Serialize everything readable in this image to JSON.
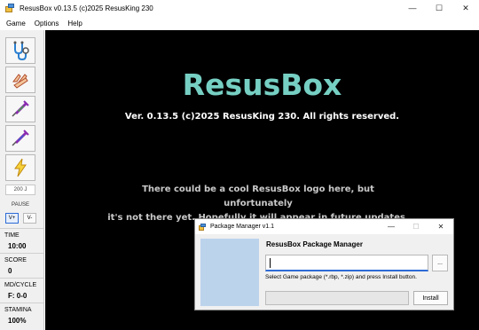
{
  "window": {
    "title": "ResusBox v0.13.5 (c)2025 ResusKing 230",
    "minimize_glyph": "—",
    "maximize_glyph": "☐",
    "close_glyph": "✕"
  },
  "menu": {
    "items": [
      {
        "label": "Game"
      },
      {
        "label": "Options"
      },
      {
        "label": "Help"
      }
    ]
  },
  "sidebar": {
    "tools": [
      {
        "icon": "stethoscope-icon"
      },
      {
        "icon": "hands-cpr-icon"
      },
      {
        "icon": "syringe-green-icon"
      },
      {
        "icon": "syringe-blue-icon"
      },
      {
        "icon": "lightning-icon"
      }
    ],
    "energy_value": "200 J",
    "pause_label": "PAUSE",
    "volume_up_label": "V+",
    "volume_down_label": "V-",
    "stats": [
      {
        "label": "TIME",
        "value": "10:00"
      },
      {
        "label": "SCORE",
        "value": "0"
      },
      {
        "label": "MD/CYCLE",
        "value": "F: 0-0"
      },
      {
        "label": "STAMINA",
        "value": "100%"
      }
    ]
  },
  "canvas": {
    "title": "ResusBox",
    "version_line": "Ver. 0.13.5 (c)2025 ResusKing 230. All rights reserved.",
    "notice_line1": "There could be a cool ResusBox logo here, but unfortunately",
    "notice_line2": "it's not there yet. Hopefully it will appear in future updates."
  },
  "package_manager": {
    "title": "Package Manager v1.1",
    "heading": "ResusBox Package Manager",
    "input_value": "",
    "browse_label": "...",
    "hint": "Select Game package (*.rbp, *.zip) and press Install button.",
    "progress": 0,
    "install_label": "Install",
    "minimize_glyph": "—",
    "maximize_glyph": "☐",
    "close_glyph": "✕"
  },
  "colors": {
    "logo_teal": "#76cfc3",
    "canvas_bg": "#000000",
    "accent_blue": "#2e6bd6",
    "image_placeholder": "#bcd3ec"
  }
}
